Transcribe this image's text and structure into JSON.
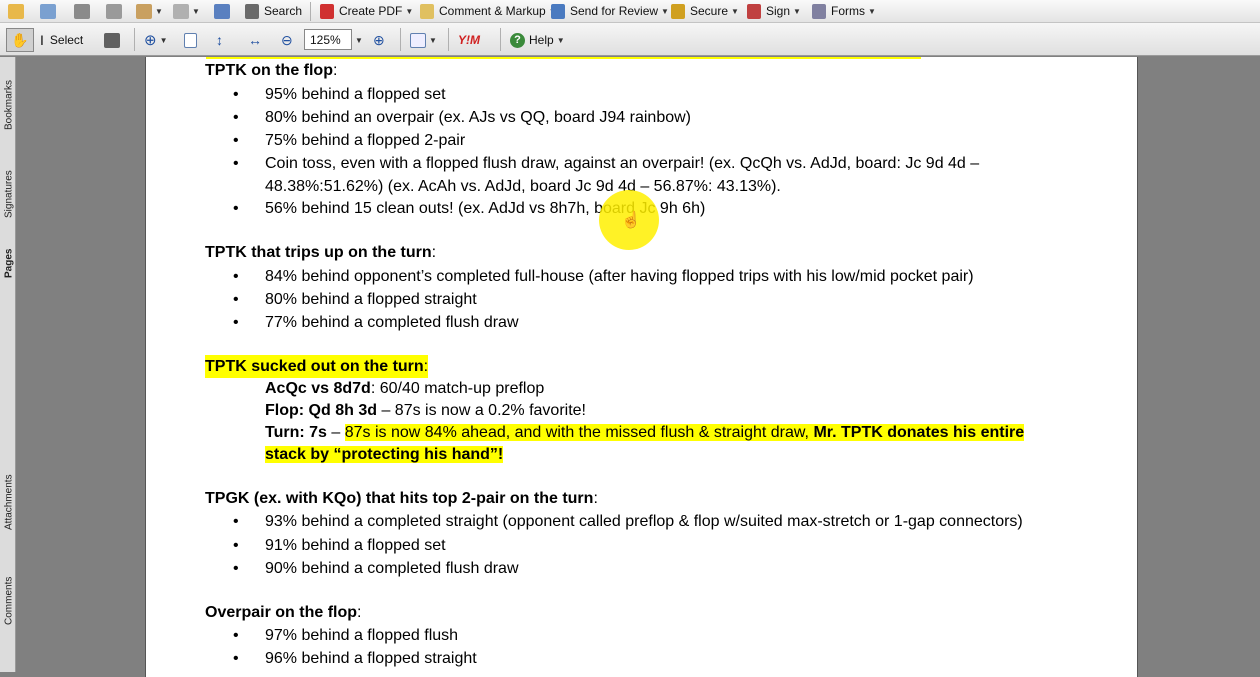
{
  "toolbar1": {
    "search": "Search",
    "create_pdf": "Create PDF",
    "comment": "Comment & Markup",
    "send": "Send for Review",
    "secure": "Secure",
    "sign": "Sign",
    "forms": "Forms"
  },
  "toolbar2": {
    "select": "Select",
    "zoom": "125%",
    "help": "Help",
    "ym": "Y!M"
  },
  "sidebar": {
    "bookmarks": "Bookmarks",
    "signatures": "Signatures",
    "pages": "Pages",
    "attachments": "Attachments",
    "comments": "Comments"
  },
  "doc": {
    "s1": {
      "title": "TPTK on the flop",
      "colon": ":",
      "b1": "95% behind a flopped set",
      "b2": "80% behind an overpair (ex. AJs vs QQ, board J94 rainbow)",
      "b3": "75% behind a flopped 2-pair",
      "b4a": "Coin toss, even with a flopped flush draw, against an overpair! (ex. QcQh vs. AdJd, board: Jc 9d 4d –",
      "b4b": "48.38%:51.62%) (ex. AcAh vs. AdJd, board Jc 9d 4d – 56.87%: 43.13%).",
      "b5": "56% behind 15 clean outs! (ex. AdJd vs 8h7h, board Jc 9h 6h)"
    },
    "s2": {
      "title": "TPTK that trips up on the turn",
      "colon": ":",
      "b1": "84% behind opponent’s completed full-house (after having flopped trips with his low/mid pocket pair)",
      "b2": "80% behind a flopped straight",
      "b3": "77% behind a completed flush draw"
    },
    "s3": {
      "title": "TPTK sucked out on the turn",
      "colon": ":",
      "l1b": "AcQc vs 8d7d",
      "l1": ": 60/40 match-up preflop",
      "l2b": "Flop: Qd 8h 3d",
      "l2": " – 87s is now a 0.2% favorite!",
      "l3b": "Turn: 7s",
      "l3": " – ",
      "l3h": "87s is now 84% ahead, and with the missed flush & straight draw, ",
      "l3hb": "Mr. TPTK donates his entire",
      "l4": "stack by “protecting his hand”!"
    },
    "s4": {
      "title": "TPGK (ex. with KQo) that hits top 2-pair on the turn",
      "colon": ":",
      "b1": "93% behind a completed straight (opponent called preflop & flop w/suited max-stretch or 1-gap connectors)",
      "b2": "91% behind a flopped set",
      "b3": "90% behind a completed flush draw"
    },
    "s5": {
      "title": "Overpair on the flop",
      "colon": ":",
      "b1": "97% behind a flopped flush",
      "b2": "96% behind a flopped straight"
    }
  }
}
